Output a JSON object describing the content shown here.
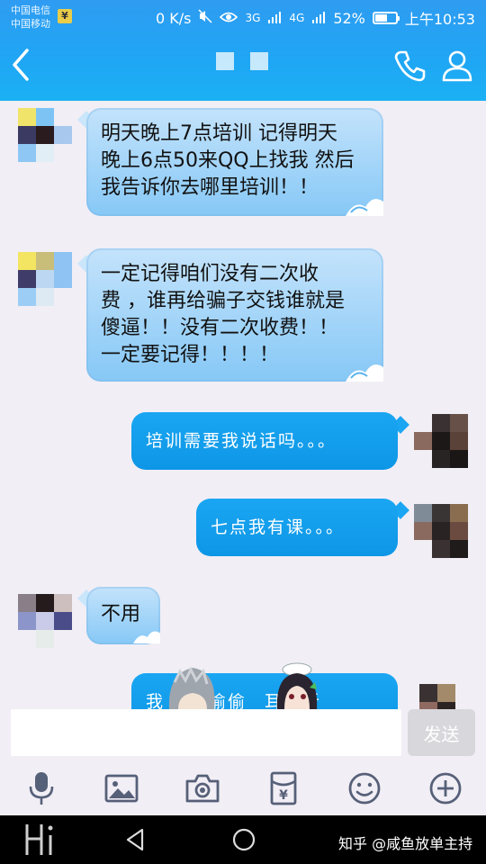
{
  "status_bar": {
    "carrier1": "中国电信",
    "carrier2": "中国移动",
    "badge": "¥",
    "net_speed": "0 K/s",
    "sig1_label": "3G",
    "sig2_label": "4G",
    "battery": "52%",
    "time": "上午10:53"
  },
  "header": {
    "icons": [
      "back-icon",
      "phone-icon",
      "person-icon"
    ]
  },
  "messages": [
    {
      "side": "left",
      "text_lines": [
        "明天晚上7点培训 记得明天",
        "晚上6点50来QQ上找我 然后",
        "我告诉你去哪里培训！！"
      ]
    },
    {
      "side": "left",
      "text_lines": [
        "一定记得咱们没有二次收",
        "费 ，谁再给骗子交钱谁就是",
        "傻逼！！没有二次收费！！",
        "一定要记得！！！！"
      ]
    },
    {
      "side": "right",
      "text": "培训需要我说话吗。。。"
    },
    {
      "side": "right",
      "text": "七点我有课。。。"
    },
    {
      "side": "left",
      "text": "不用"
    },
    {
      "side": "right",
      "text_parts": [
        "我",
        "能偷偷",
        "耳机听"
      ]
    }
  ],
  "input": {
    "value": "",
    "send_label": "发送"
  },
  "toolbar": {
    "icons": [
      "microphone-icon",
      "image-icon",
      "camera-icon",
      "red-packet-icon",
      "emoji-icon",
      "plus-icon"
    ]
  },
  "navbar": {
    "watermark": "知乎 @咸鱼放单主持"
  },
  "colors": {
    "header": "#1fa6f4",
    "bubble_right": "#1aa6f2",
    "bubble_left": "#a6d6f8",
    "background": "#f1eef5"
  }
}
